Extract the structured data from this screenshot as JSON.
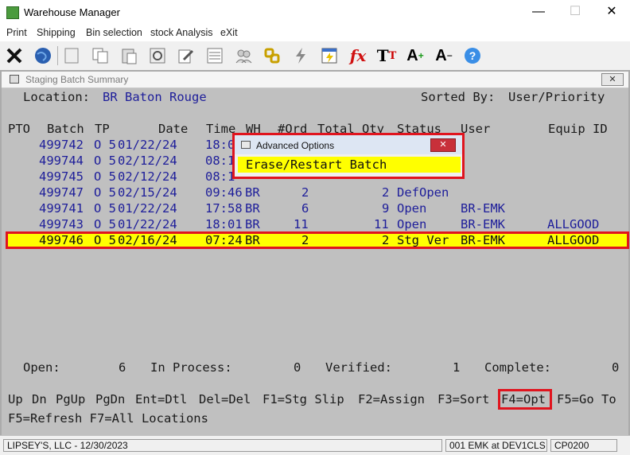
{
  "window": {
    "title": "Warehouse Manager",
    "minimize": "—",
    "maximize": "☐",
    "close": "✕"
  },
  "menu": [
    {
      "label": "Print"
    },
    {
      "label": "Shipping"
    },
    {
      "label": "Bin selection"
    },
    {
      "label": "stock Analysis"
    },
    {
      "label": "eXit"
    }
  ],
  "toolbar": [
    "exit-icon",
    "globe-icon",
    "blank-doc-icon",
    "copy-icon",
    "paste-icon",
    "settings-icon",
    "edit-icon",
    "list-icon",
    "users-icon",
    "link-icon",
    "lightning-icon",
    "report-icon",
    "function-icon",
    "font-icon",
    "font-increase-icon",
    "font-decrease-icon",
    "help-icon"
  ],
  "child": {
    "title": "Staging Batch Summary",
    "close": "✕"
  },
  "summary": {
    "location_label": "Location:",
    "location_value": "BR Baton Rouge",
    "sorted_label": "Sorted By:",
    "sorted_value": "User/Priority"
  },
  "headers": {
    "pto": "PTO",
    "batch": "Batch",
    "tp": "TP",
    "date": "Date",
    "time": "Time",
    "wh": "WH",
    "ord": "#Ord",
    "qty": "Total Qty",
    "status": "Status",
    "user": "User",
    "equip": "Equip ID"
  },
  "rows": [
    {
      "batch": "499742",
      "tp": "O 5",
      "date": "01/22/24",
      "time": "18:0",
      "wh": "",
      "ord": "",
      "qty": "",
      "status": "",
      "user": "",
      "equip": ""
    },
    {
      "batch": "499744",
      "tp": "O 5",
      "date": "02/12/24",
      "time": "08:1",
      "wh": "",
      "ord": "",
      "qty": "",
      "status": "",
      "user": "",
      "equip": ""
    },
    {
      "batch": "499745",
      "tp": "O 5",
      "date": "02/12/24",
      "time": "08:1",
      "wh": "",
      "ord": "",
      "qty": "",
      "status": "",
      "user": "",
      "equip": ""
    },
    {
      "batch": "499747",
      "tp": "O 5",
      "date": "02/15/24",
      "time": "09:46",
      "wh": "BR",
      "ord": "2",
      "qty": "2",
      "status": "DefOpen",
      "user": "",
      "equip": ""
    },
    {
      "batch": "499741",
      "tp": "O 5",
      "date": "01/22/24",
      "time": "17:58",
      "wh": "BR",
      "ord": "6",
      "qty": "9",
      "status": "Open",
      "user": "BR-EMK",
      "equip": ""
    },
    {
      "batch": "499743",
      "tp": "O 5",
      "date": "01/22/24",
      "time": "18:01",
      "wh": "BR",
      "ord": "11",
      "qty": "11",
      "status": "Open",
      "user": "BR-EMK",
      "equip": "ALLGOOD"
    },
    {
      "batch": "499746",
      "tp": "O 5",
      "date": "02/16/24",
      "time": "07:24",
      "wh": "BR",
      "ord": "2",
      "qty": "2",
      "status": "Stg Ver",
      "user": "BR-EMK",
      "equip": "ALLGOOD"
    }
  ],
  "dialog": {
    "title": "Advanced Options",
    "close": "✕",
    "option": "Erase/Restart Batch"
  },
  "totals": {
    "open_label": "Open:",
    "open_value": "6",
    "inproc_label": "In Process:",
    "inproc_value": "0",
    "verified_label": "Verified:",
    "verified_value": "1",
    "complete_label": "Complete:",
    "complete_value": "0"
  },
  "keys1": [
    "Up",
    "Dn",
    "PgUp",
    "PgDn",
    "Ent=Dtl",
    "Del=Del",
    "F1=Stg Slip",
    "F2=Assign",
    "F3=Sort",
    "F4=Opt",
    "F5=Go To"
  ],
  "keys2": "F5=Refresh F7=All Locations",
  "status": {
    "company": "LIPSEY'S, LLC - 12/30/2023",
    "session": "001 EMK at DEV1CLS",
    "program": "CP0200"
  }
}
